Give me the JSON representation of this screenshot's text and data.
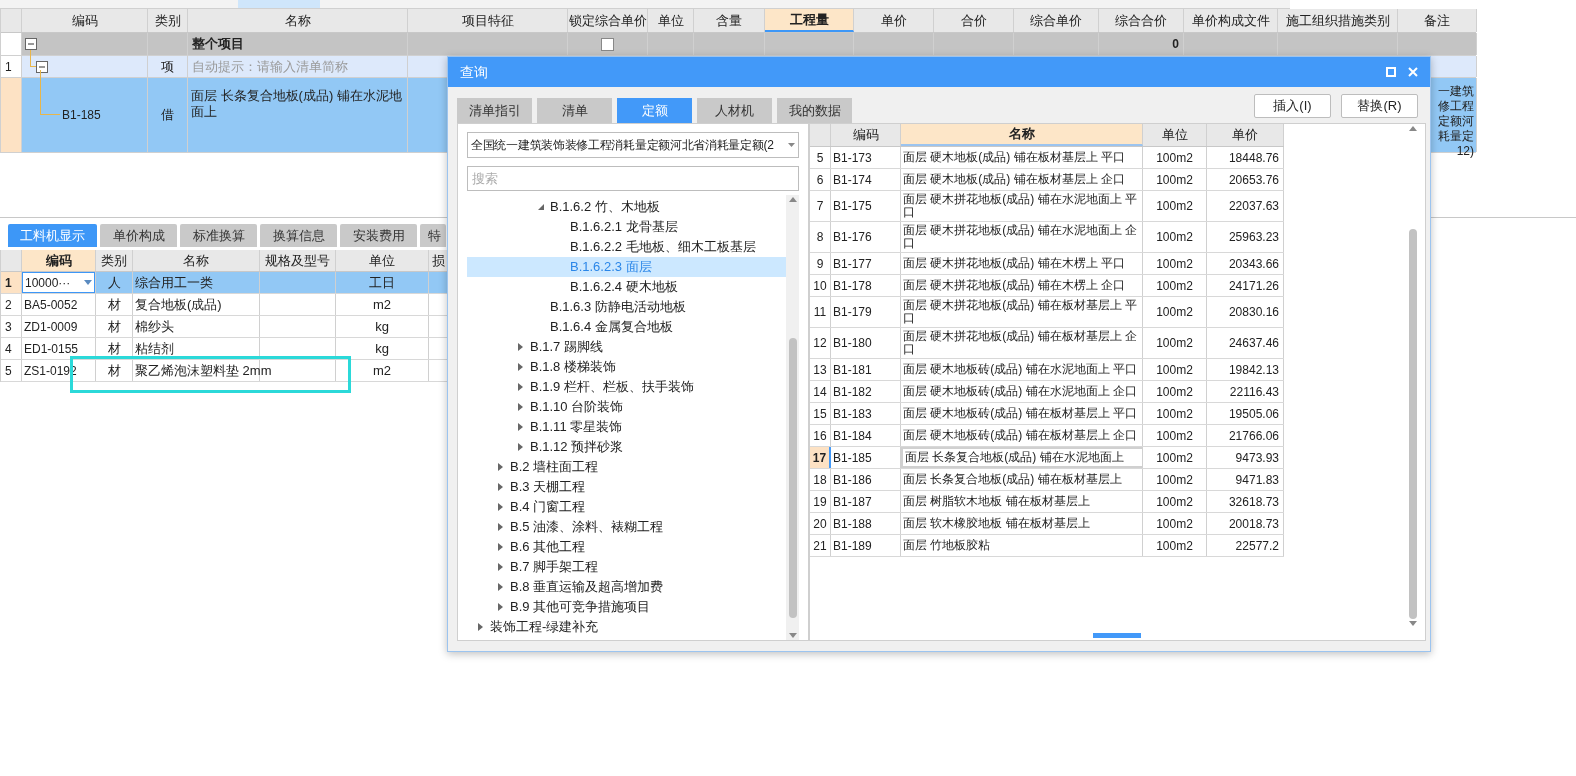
{
  "top_table": {
    "columns": [
      {
        "label": "编码",
        "selected": false
      },
      {
        "label": "类别",
        "selected": false
      },
      {
        "label": "名称",
        "selected": false
      },
      {
        "label": "项目特征",
        "selected": false
      },
      {
        "label": "锁定综合单价",
        "selected": false
      },
      {
        "label": "单位",
        "selected": false
      },
      {
        "label": "含量",
        "selected": false
      },
      {
        "label": "工程量",
        "selected": true
      },
      {
        "label": "单价",
        "selected": false
      },
      {
        "label": "合价",
        "selected": false
      },
      {
        "label": "综合单价",
        "selected": false
      },
      {
        "label": "综合合价",
        "selected": false
      },
      {
        "label": "单价构成文件",
        "selected": false
      },
      {
        "label": "施工组织措施类别",
        "selected": false
      },
      {
        "label": "备注",
        "selected": false
      }
    ],
    "rows": [
      {
        "kind": "total",
        "expanded": true,
        "name": "整个项目",
        "locked": false,
        "total_price": "0",
        "selected": false
      },
      {
        "kind": "item",
        "number": "1",
        "expanded": true,
        "type": "项",
        "placeholder": "自动提示：请输入清单简称",
        "selected": false
      },
      {
        "kind": "quota",
        "code": "B1-185",
        "type": "借",
        "name": "面层 长条复合地板(成品) 铺在水泥地面上",
        "remark_lines": [
          "一建筑",
          "修工程",
          "定额河",
          "耗量定",
          "12)"
        ],
        "selected": true
      }
    ]
  },
  "bottom_tabs": [
    {
      "label": "工料机显示",
      "selected": true
    },
    {
      "label": "单价构成",
      "selected": false
    },
    {
      "label": "标准换算",
      "selected": false
    },
    {
      "label": "换算信息",
      "selected": false
    },
    {
      "label": "安装费用",
      "selected": false
    },
    {
      "label": "特",
      "selected": false
    }
  ],
  "bottom_table": {
    "columns": [
      {
        "label": "编码",
        "selected": true
      },
      {
        "label": "类别",
        "selected": false
      },
      {
        "label": "名称",
        "selected": false
      },
      {
        "label": "规格及型号",
        "selected": false
      },
      {
        "label": "单位",
        "selected": false
      },
      {
        "label": "损",
        "selected": false
      }
    ],
    "rows": [
      {
        "number": "1",
        "code": "10000···",
        "type": "人",
        "name": "综合用工一类",
        "unit": "工日",
        "selected": true
      },
      {
        "number": "2",
        "code": "BA5-0052",
        "type": "材",
        "name": "复合地板(成品)",
        "unit": "m2",
        "selected": false
      },
      {
        "number": "3",
        "code": "ZD1-0009",
        "type": "材",
        "name": "棉纱头",
        "unit": "kg",
        "selected": false
      },
      {
        "number": "4",
        "code": "ED1-0155",
        "type": "材",
        "name": "粘结剂",
        "unit": "kg",
        "selected": false
      },
      {
        "number": "5",
        "code": "ZS1-0192",
        "type": "材",
        "name": "聚乙烯泡沫塑料垫 2mm",
        "unit": "m2",
        "selected": false
      }
    ]
  },
  "dialog": {
    "title": "查询",
    "tabs": [
      {
        "label": "清单指引",
        "selected": false
      },
      {
        "label": "清单",
        "selected": false
      },
      {
        "label": "定额",
        "selected": true
      },
      {
        "label": "人材机",
        "selected": false
      },
      {
        "label": "我的数据",
        "selected": false
      }
    ],
    "buttons": [
      "插入(I)",
      "替换(R)"
    ],
    "library": "全国统一建筑装饰装修工程消耗量定额河北省消耗量定额(2",
    "search": {
      "placeholder": "搜索"
    },
    "tree": [
      {
        "children": [
          {
            "children": [
              {
                "children": [
                  {
                    "label": "B.1.6.2 竹、木地板",
                    "expanded": true,
                    "selected": false,
                    "children": [
                      {
                        "label": "B.1.6.2.1 龙骨基层",
                        "selected": false
                      },
                      {
                        "label": "B.1.6.2.2 毛地板、细木工板基层",
                        "selected": false
                      },
                      {
                        "label": "B.1.6.2.3 面层",
                        "selected": true
                      },
                      {
                        "label": "B.1.6.2.4 硬木地板",
                        "selected": false
                      }
                    ]
                  },
                  {
                    "label": "B.1.6.3 防静电活动地板",
                    "selected": false
                  },
                  {
                    "label": "B.1.6.4 金属复合地板",
                    "selected": false
                  }
                ]
              },
              {
                "label": "B.1.7 踢脚线",
                "expanded": false,
                "selected": false
              },
              {
                "label": "B.1.8 楼梯装饰",
                "expanded": false,
                "selected": false
              },
              {
                "label": "B.1.9 栏杆、栏板、扶手装饰",
                "expanded": false,
                "selected": false
              },
              {
                "label": "B.1.10 台阶装饰",
                "expanded": false,
                "selected": false
              },
              {
                "label": "B.1.11 零星装饰",
                "expanded": false,
                "selected": false
              },
              {
                "label": "B.1.12 预拌砂浆",
                "expanded": false,
                "selected": false
              }
            ]
          },
          {
            "label": "B.2 墙柱面工程",
            "expanded": false,
            "selected": false
          },
          {
            "label": "B.3 天棚工程",
            "expanded": false,
            "selected": false
          },
          {
            "label": "B.4 门窗工程",
            "expanded": false,
            "selected": false
          },
          {
            "label": "B.5 油漆、涂料、裱糊工程",
            "expanded": false,
            "selected": false
          },
          {
            "label": "B.6 其他工程",
            "expanded": false,
            "selected": false
          },
          {
            "label": "B.7 脚手架工程",
            "expanded": false,
            "selected": false
          },
          {
            "label": "B.8 垂直运输及超高增加费",
            "expanded": false,
            "selected": false
          },
          {
            "label": "B.9 其他可竞争措施项目",
            "expanded": false,
            "selected": false
          }
        ]
      },
      {
        "label": "装饰工程-绿建补充",
        "expanded": false,
        "selected": false
      }
    ],
    "table": {
      "columns": [
        {
          "label": "编码",
          "selected": false
        },
        {
          "label": "名称",
          "selected": true
        },
        {
          "label": "单位",
          "selected": false
        },
        {
          "label": "单价",
          "selected": false
        }
      ],
      "rows": [
        {
          "number": "5",
          "code": "B1-173",
          "name": "面层 硬木地板(成品) 铺在板材基层上 平口",
          "unit": "100m2",
          "price": "18448.76",
          "selected": false
        },
        {
          "number": "6",
          "code": "B1-174",
          "name": "面层 硬木地板(成品) 铺在板材基层上 企口",
          "unit": "100m2",
          "price": "20653.76",
          "selected": false
        },
        {
          "number": "7",
          "code": "B1-175",
          "name": "面层 硬木拼花地板(成品) 铺在水泥地面上 平口",
          "unit": "100m2",
          "price": "22037.63",
          "selected": false
        },
        {
          "number": "8",
          "code": "B1-176",
          "name": "面层 硬木拼花地板(成品) 铺在水泥地面上 企口",
          "unit": "100m2",
          "price": "25963.23",
          "selected": false
        },
        {
          "number": "9",
          "code": "B1-177",
          "name": "面层 硬木拼花地板(成品) 铺在木楞上 平口",
          "unit": "100m2",
          "price": "20343.66",
          "selected": false
        },
        {
          "number": "10",
          "code": "B1-178",
          "name": "面层 硬木拼花地板(成品) 铺在木楞上 企口",
          "unit": "100m2",
          "price": "24171.26",
          "selected": false
        },
        {
          "number": "11",
          "code": "B1-179",
          "name": "面层 硬木拼花地板(成品) 铺在板材基层上 平口",
          "unit": "100m2",
          "price": "20830.16",
          "selected": false
        },
        {
          "number": "12",
          "code": "B1-180",
          "name": "面层 硬木拼花地板(成品) 铺在板材基层上 企口",
          "unit": "100m2",
          "price": "24637.46",
          "selected": false
        },
        {
          "number": "13",
          "code": "B1-181",
          "name": "面层 硬木地板砖(成品) 铺在水泥地面上 平口",
          "unit": "100m2",
          "price": "19842.13",
          "selected": false
        },
        {
          "number": "14",
          "code": "B1-182",
          "name": "面层 硬木地板砖(成品) 铺在水泥地面上 企口",
          "unit": "100m2",
          "price": "22116.43",
          "selected": false
        },
        {
          "number": "15",
          "code": "B1-183",
          "name": "面层 硬木地板砖(成品) 铺在板材基层上 平口",
          "unit": "100m2",
          "price": "19505.06",
          "selected": false
        },
        {
          "number": "16",
          "code": "B1-184",
          "name": "面层 硬木地板砖(成品) 铺在板材基层上 企口",
          "unit": "100m2",
          "price": "21766.06",
          "selected": false
        },
        {
          "number": "17",
          "code": "B1-185",
          "name": "面层 长条复合地板(成品) 铺在水泥地面上",
          "unit": "100m2",
          "price": "9473.93",
          "selected": true
        },
        {
          "number": "18",
          "code": "B1-186",
          "name": "面层 长条复合地板(成品) 铺在板材基层上",
          "unit": "100m2",
          "price": "9471.83",
          "selected": false
        },
        {
          "number": "19",
          "code": "B1-187",
          "name": "面层 树脂软木地板 铺在板材基层上",
          "unit": "100m2",
          "price": "32618.73",
          "selected": false
        },
        {
          "number": "20",
          "code": "B1-188",
          "name": "面层 软木橡胶地板 铺在板材基层上",
          "unit": "100m2",
          "price": "20018.73",
          "selected": false
        },
        {
          "number": "21",
          "code": "B1-189",
          "name": "面层 竹地板胶粘",
          "unit": "100m2",
          "price": "22577.2",
          "selected": false
        }
      ]
    }
  }
}
